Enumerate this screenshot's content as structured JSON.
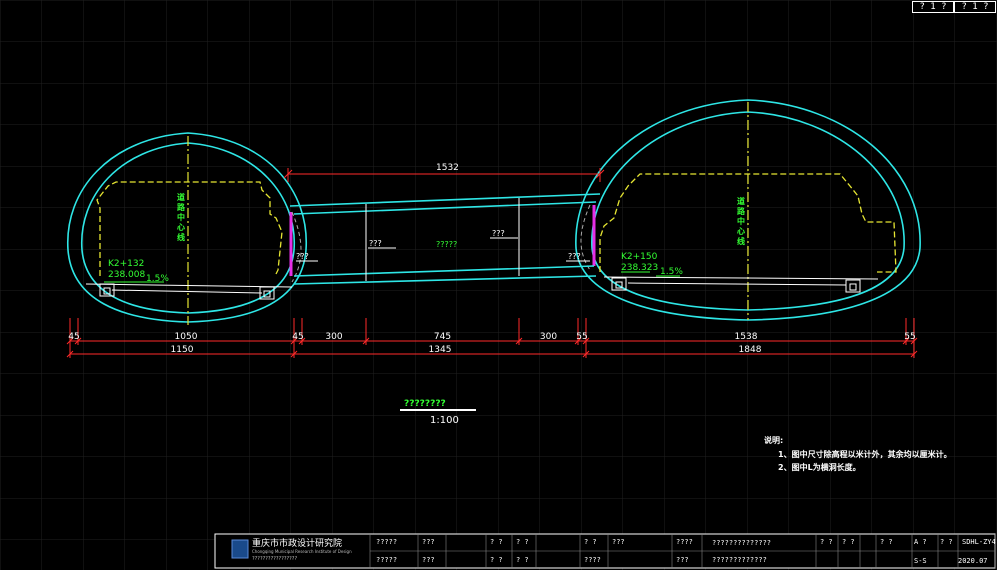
{
  "top_boxes": [
    "? 1 ?",
    "? 1 ?"
  ],
  "labels": {
    "left_centerline": [
      "道",
      "路",
      "中",
      "心",
      "线"
    ],
    "right_centerline": [
      "道",
      "路",
      "中",
      "心",
      "线"
    ],
    "left_station": "K2+132",
    "left_elevation": "238.008",
    "left_slope": "1.5%",
    "right_station": "K2+150",
    "right_elevation": "238.323",
    "right_slope": "1.5%",
    "left_portal_tag": "???",
    "right_portal_tag": "???",
    "pass_left_tag": "???",
    "pass_right_tag": "???",
    "pass_center_tag": "?????",
    "top_dim": "1532",
    "section_title": "????????",
    "scale": "1:100"
  },
  "dims_row1": [
    "45",
    "1050",
    "45",
    "300",
    "745",
    "300",
    "55",
    "1538",
    "55"
  ],
  "dims_row2": [
    "1150",
    "1345",
    "1848"
  ],
  "notes": {
    "title": "说明:",
    "lines": [
      "1、图中尺寸除高程以米计外，其余均以厘米计。",
      "2、图中L为横洞长度。"
    ]
  },
  "title_block": {
    "company_cn": "重庆市市政设计研究院",
    "company_en": "Chongqing Municipal Research Institute of Design",
    "address": "?????????????????",
    "cells": [
      "?????",
      "???",
      "? ?",
      "? ?",
      "? ?",
      "???",
      "????",
      "??????????????",
      "? ?",
      "? ?",
      "? ?",
      "A ?",
      "? ?",
      "SDHL-ZY4",
      "?????",
      "???",
      "? ?",
      "? ?",
      "????",
      "???",
      "?????????????",
      "S-S",
      "2020.07"
    ]
  },
  "colors": {
    "lining": "#2ee6e6",
    "centerline": "#e6e632",
    "clearance": "#e6e632",
    "dims": "#ff2a2a",
    "green_text": "#33ff33",
    "waterproof": "#e62ee6",
    "grid": "#1c1c1c"
  }
}
